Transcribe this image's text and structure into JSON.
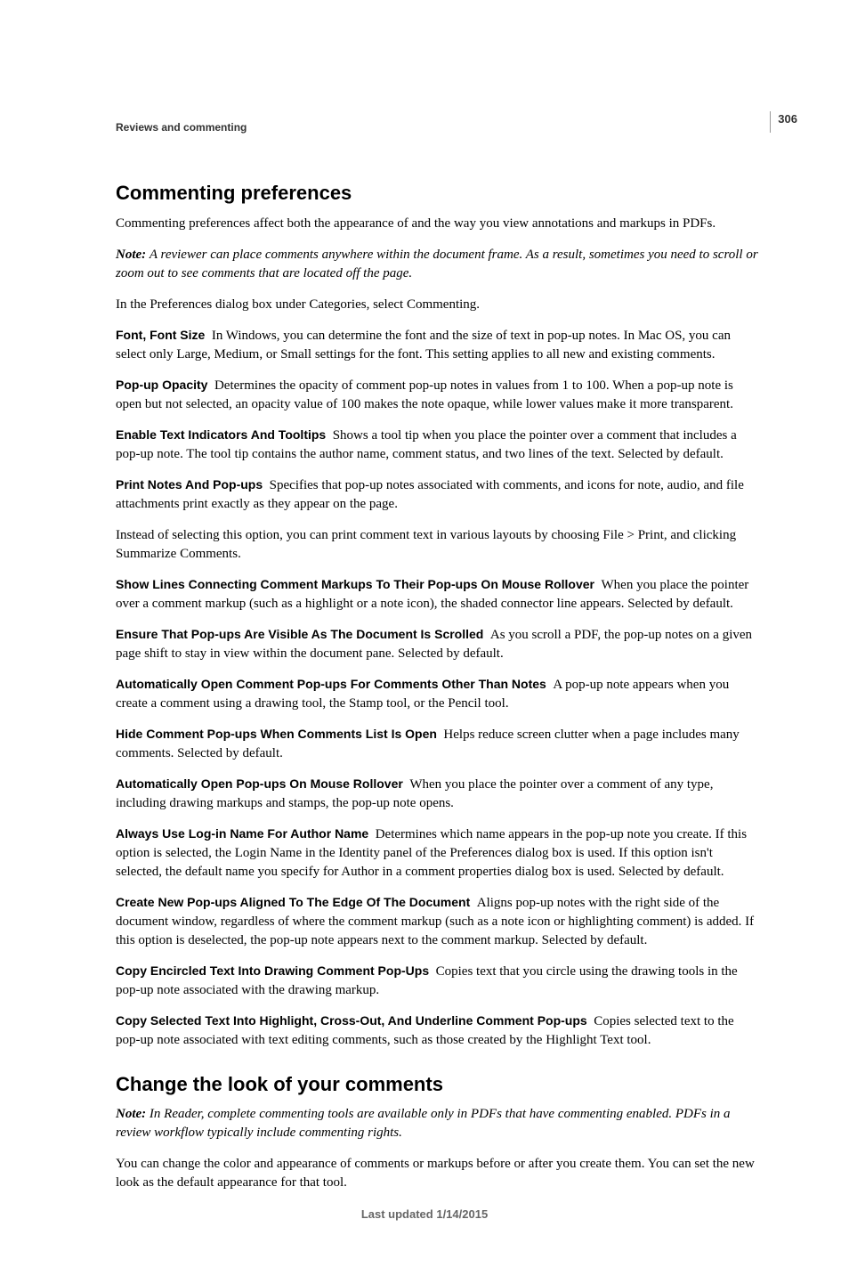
{
  "pageNumber": "306",
  "breadcrumb": "Reviews and commenting",
  "section1": {
    "heading": "Commenting preferences",
    "intro": "Commenting preferences affect both the appearance of and the way you view annotations and markups in PDFs.",
    "noteLabel": "Note: ",
    "noteBody": "A reviewer can place comments anywhere within the document frame. As a result, sometimes you need to scroll or zoom out to see comments that are located off the page.",
    "pref_line": "In the Preferences dialog box under Categories, select Commenting.",
    "defs": [
      {
        "term": "Font, Font Size",
        "desc": "In Windows, you can determine the font and the size of text in pop-up notes. In Mac OS, you can select only Large, Medium, or Small settings for the font. This setting applies to all new and existing comments."
      },
      {
        "term": "Pop-up Opacity",
        "desc": "Determines the opacity of comment pop-up notes in values from 1 to 100. When a pop-up note is open but not selected, an opacity value of 100 makes the note opaque, while lower values make it more transparent."
      },
      {
        "term": "Enable Text Indicators And Tooltips",
        "desc": "Shows a tool tip when you place the pointer over a comment that includes a pop-up note. The tool tip contains the author name, comment status, and two lines of the text. Selected by default."
      },
      {
        "term": "Print Notes And Pop-ups",
        "desc": "Specifies that pop-up notes associated with comments, and icons for note, audio, and file attachments print exactly as they appear on the page."
      }
    ],
    "print_extra": "Instead of selecting this option, you can print comment text in various layouts by choosing File > Print, and clicking Summarize Comments.",
    "defs2": [
      {
        "term": "Show Lines Connecting Comment Markups To Their Pop-ups On Mouse Rollover",
        "desc": "When you place the pointer over a comment markup (such as a highlight or a note icon), the shaded connector line appears. Selected by default."
      },
      {
        "term": "Ensure That Pop-ups Are Visible As The Document Is Scrolled",
        "desc": "As you scroll a PDF, the pop-up notes on a given page shift to stay in view within the document pane. Selected by default."
      },
      {
        "term": "Automatically Open Comment Pop-ups For Comments Other Than Notes",
        "desc": "A pop-up note appears when you create a comment using a drawing tool, the Stamp tool, or the Pencil tool."
      },
      {
        "term": "Hide Comment Pop-ups When Comments List Is Open",
        "desc": "Helps reduce screen clutter when a page includes many comments. Selected by default."
      },
      {
        "term": "Automatically Open Pop-ups On Mouse Rollover",
        "desc": "When you place the pointer over a comment of any type, including drawing markups and stamps, the pop-up note opens."
      },
      {
        "term": "Always Use Log-in Name For Author Name",
        "desc": "Determines which name appears in the pop-up note you create. If this option is selected, the Login Name in the Identity panel of the Preferences dialog box is used. If this option isn't selected, the default name you specify for Author in a comment properties dialog box is used. Selected by default."
      },
      {
        "term": "Create New Pop-ups Aligned To The Edge Of The Document",
        "desc": "Aligns pop-up notes with the right side of the document window, regardless of where the comment markup (such as a note icon or highlighting comment) is added. If this option is deselected, the pop-up note appears next to the comment markup. Selected by default."
      },
      {
        "term": "Copy Encircled Text Into Drawing Comment Pop-Ups",
        "desc": "Copies text that you circle using the drawing tools in the pop-up note associated with the drawing markup."
      },
      {
        "term": "Copy Selected Text Into Highlight, Cross-Out, And Underline Comment Pop-ups",
        "desc": "Copies selected text to the pop-up note associated with text editing comments, such as those created by the Highlight Text tool."
      }
    ]
  },
  "section2": {
    "heading": "Change the look of your comments",
    "noteLabel": "Note: ",
    "noteBody": "In Reader, complete commenting tools are available only in PDFs that have commenting enabled. PDFs in a review workflow typically include commenting rights.",
    "body": "You can change the color and appearance of comments or markups before or after you create them. You can set the new look as the default appearance for that tool."
  },
  "footer": "Last updated 1/14/2015"
}
